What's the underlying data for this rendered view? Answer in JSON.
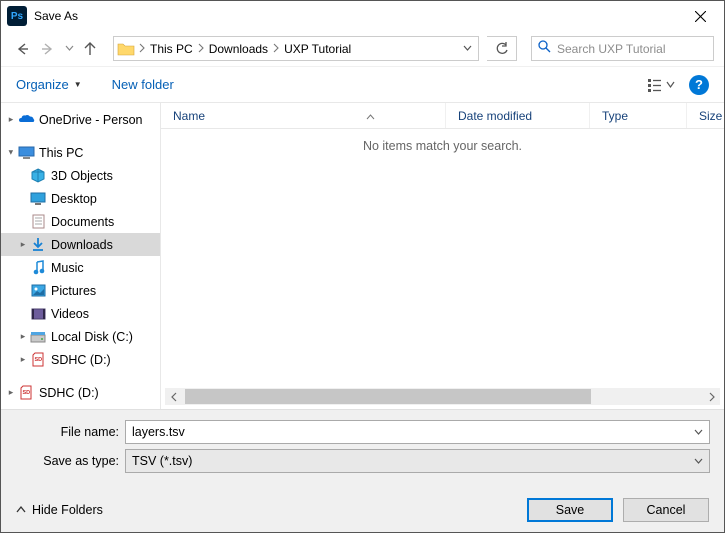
{
  "title": "Save As",
  "breadcrumbs": {
    "items": [
      "This PC",
      "Downloads",
      "UXP Tutorial"
    ]
  },
  "search": {
    "placeholder": "Search UXP Tutorial"
  },
  "toolbar": {
    "organize": "Organize",
    "new_folder": "New folder"
  },
  "columns": {
    "name": "Name",
    "modified": "Date modified",
    "type": "Type",
    "size": "Size"
  },
  "empty_text": "No items match your search.",
  "tree": {
    "onedrive": "OneDrive - Person",
    "thispc": "This PC",
    "children": {
      "objects3d": "3D Objects",
      "desktop": "Desktop",
      "documents": "Documents",
      "downloads": "Downloads",
      "music": "Music",
      "pictures": "Pictures",
      "videos": "Videos",
      "c": "Local Disk (C:)",
      "d": "SDHC (D:)",
      "d2": "SDHC (D:)"
    }
  },
  "form": {
    "filename_label": "File name:",
    "filename_value": "layers.tsv",
    "type_label": "Save as type:",
    "type_value": "TSV (*.tsv)"
  },
  "footer": {
    "hide": "Hide Folders",
    "save": "Save",
    "cancel": "Cancel"
  },
  "help_glyph": "?"
}
